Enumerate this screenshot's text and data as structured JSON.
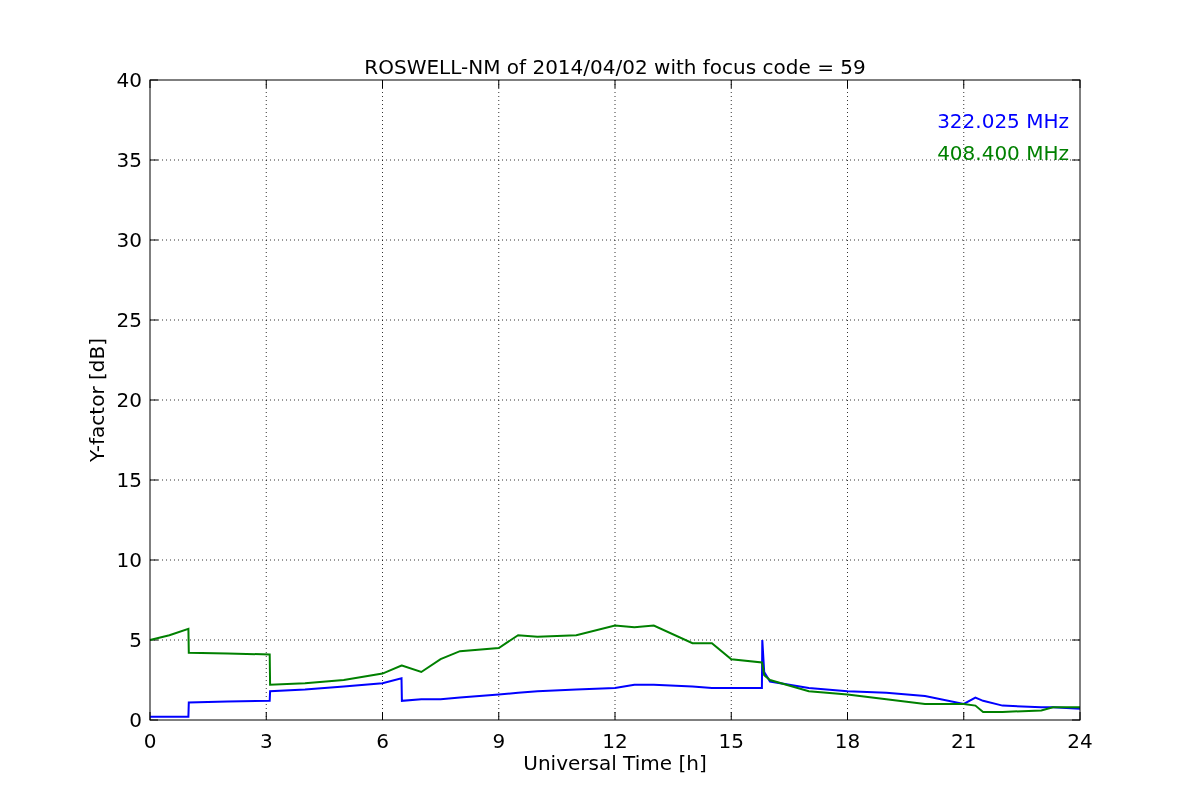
{
  "chart_data": {
    "type": "line",
    "title": "ROSWELL-NM of 2014/04/02 with focus code = 59",
    "xlabel": "Universal Time [h]",
    "ylabel": "Y-factor [dB]",
    "x": [
      0,
      0.5,
      0.99,
      1,
      2,
      3.09,
      3.1,
      4,
      5,
      6,
      6.49,
      6.5,
      7,
      7.5,
      8,
      9,
      9.5,
      10,
      11,
      12,
      12.5,
      13,
      14,
      14.5,
      15,
      15.79,
      15.8,
      15.85,
      16,
      17,
      18,
      19,
      20,
      21,
      21.3,
      21.5,
      22,
      23,
      23.3,
      24
    ],
    "series": [
      {
        "name": "322.025 MHz",
        "color": "#0000ff",
        "values": [
          0.2,
          0.2,
          0.2,
          1.1,
          1.15,
          1.2,
          1.8,
          1.9,
          2.1,
          2.3,
          2.6,
          1.2,
          1.3,
          1.3,
          1.4,
          1.6,
          1.7,
          1.8,
          1.9,
          2.0,
          2.2,
          2.2,
          2.1,
          2.0,
          2.0,
          2.0,
          5.0,
          3.0,
          2.4,
          2.0,
          1.8,
          1.7,
          1.5,
          1.0,
          1.4,
          1.2,
          0.9,
          0.8,
          0.8,
          0.7
        ]
      },
      {
        "name": "408.400 MHz",
        "color": "#008000",
        "values": [
          5.0,
          5.3,
          5.7,
          4.2,
          4.15,
          4.1,
          2.2,
          2.3,
          2.5,
          2.9,
          3.4,
          3.4,
          3.0,
          3.8,
          4.3,
          4.5,
          5.3,
          5.2,
          5.3,
          5.9,
          5.8,
          5.9,
          4.8,
          4.8,
          3.8,
          3.6,
          3.5,
          2.8,
          2.5,
          1.8,
          1.6,
          1.3,
          1.0,
          1.0,
          0.9,
          0.5,
          0.5,
          0.6,
          0.8,
          0.8
        ]
      }
    ],
    "grid": true,
    "xlim": [
      0,
      24
    ],
    "ylim": [
      0,
      40
    ],
    "xticks": [
      0,
      3,
      6,
      9,
      12,
      15,
      18,
      21,
      24
    ],
    "yticks": [
      0,
      5,
      10,
      15,
      20,
      25,
      30,
      35,
      40
    ]
  }
}
